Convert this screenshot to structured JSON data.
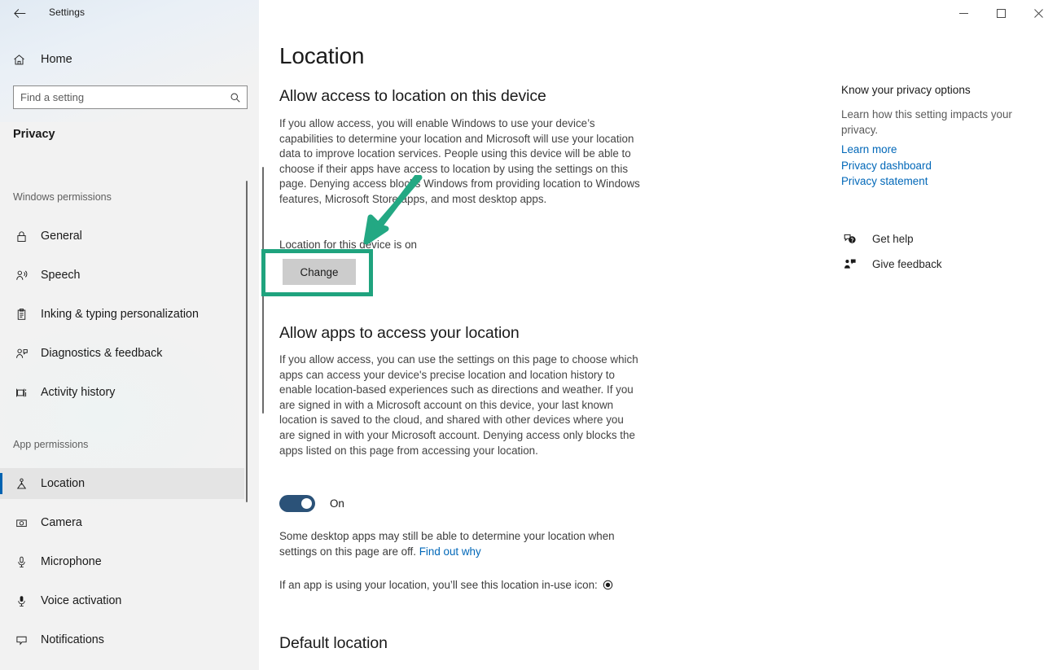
{
  "window": {
    "app_title": "Settings",
    "back_icon": "back-arrow-icon",
    "minimize_label": "Minimize",
    "maximize_label": "Maximize",
    "close_label": "Close"
  },
  "sidebar": {
    "home_label": "Home",
    "home_icon": "home-icon",
    "search": {
      "placeholder": "Find a setting",
      "value": "",
      "icon": "search-icon"
    },
    "category": "Privacy",
    "groups": [
      {
        "heading": "Windows permissions",
        "items": [
          {
            "label": "General",
            "icon": "lock-icon",
            "selected": false
          },
          {
            "label": "Speech",
            "icon": "speech-person-icon",
            "selected": false
          },
          {
            "label": "Inking & typing personalization",
            "icon": "clipboard-pen-icon",
            "selected": false
          },
          {
            "label": "Diagnostics & feedback",
            "icon": "person-feedback-icon",
            "selected": false
          },
          {
            "label": "Activity history",
            "icon": "activity-history-icon",
            "selected": false
          }
        ]
      },
      {
        "heading": "App permissions",
        "items": [
          {
            "label": "Location",
            "icon": "location-pin-icon",
            "selected": true
          },
          {
            "label": "Camera",
            "icon": "camera-icon",
            "selected": false
          },
          {
            "label": "Microphone",
            "icon": "microphone-icon",
            "selected": false
          },
          {
            "label": "Voice activation",
            "icon": "voice-activation-icon",
            "selected": false
          },
          {
            "label": "Notifications",
            "icon": "notification-bubble-icon",
            "selected": false
          }
        ]
      }
    ]
  },
  "main": {
    "page_title": "Location",
    "device_section": {
      "heading": "Allow access to location on this device",
      "paragraph": "If you allow access, you will enable Windows to use your device’s capabilities to determine your location and Microsoft will use your location data to improve location services. People using this device will be able to choose if their apps have access to location by using the settings on this page. Denying access blocks Windows from providing location to Windows features, Microsoft Store apps, and most desktop apps.",
      "status": "Location for this device is on",
      "change_button": "Change"
    },
    "apps_section": {
      "heading": "Allow apps to access your location",
      "paragraph": "If you allow access, you can use the settings on this page to choose which apps can access your device's precise location and location history to enable location-based experiences such as directions and weather. If you are signed in with a Microsoft account on this device, your last known location is saved to the cloud, and shared with other devices where you are signed in with your Microsoft account. Denying access only blocks the apps listed on this page from accessing your location.",
      "toggle_state": "On",
      "note_text": "Some desktop apps may still be able to determine your location when settings on this page are off.",
      "note_link": "Find out why",
      "inuse_text": "If an app is using your location, you’ll see this location in-use icon:",
      "inuse_icon": "location-in-use-icon"
    },
    "default_section": {
      "heading": "Default location"
    }
  },
  "right_panel": {
    "title": "Know your privacy options",
    "description": "Learn how this setting impacts your privacy.",
    "links": [
      "Learn more",
      "Privacy dashboard",
      "Privacy statement"
    ],
    "actions": [
      {
        "label": "Get help",
        "icon": "question-chat-icon"
      },
      {
        "label": "Give feedback",
        "icon": "feedback-person-icon"
      }
    ]
  },
  "annotation": {
    "color": "#1fa37e",
    "highlight_target": "Change",
    "arrow_icon": "annotation-arrow-icon",
    "box_icon": "annotation-box-icon"
  }
}
